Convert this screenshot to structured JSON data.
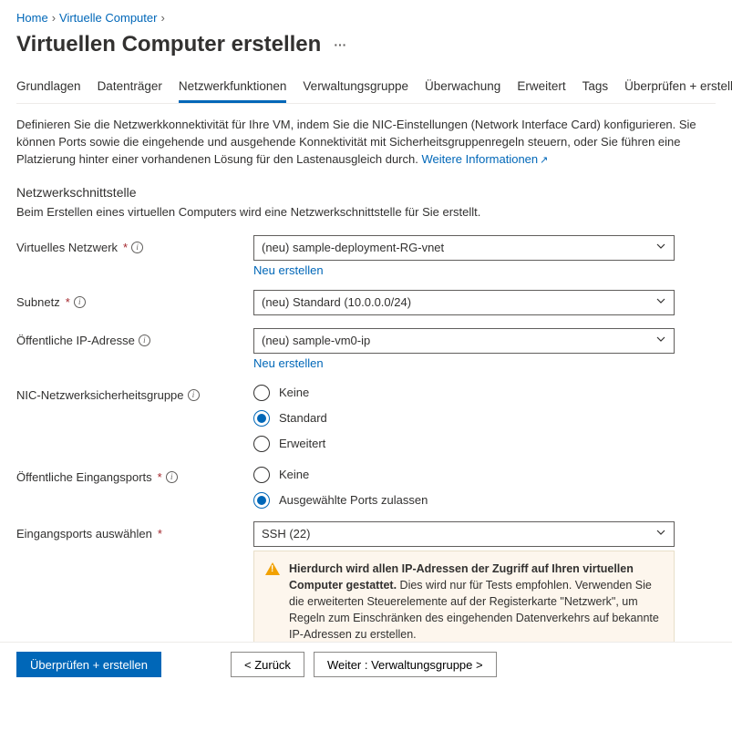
{
  "breadcrumb": {
    "home": "Home",
    "vms": "Virtuelle Computer"
  },
  "title": "Virtuellen Computer erstellen",
  "tabs": {
    "basics": "Grundlagen",
    "disks": "Datenträger",
    "networking": "Netzwerkfunktionen",
    "management": "Verwaltungsgruppe",
    "monitoring": "Überwachung",
    "advanced": "Erweitert",
    "tags": "Tags",
    "review": "Überprüfen + erstellen"
  },
  "intro": {
    "text": "Definieren Sie die Netzwerkkonnektivität für Ihre VM, indem Sie die NIC-Einstellungen (Network Interface Card) konfigurieren. Sie können Ports sowie die eingehende und ausgehende Konnektivität mit Sicherheitsgruppenregeln steuern, oder Sie führen eine Platzierung hinter einer vorhandenen Lösung für den Lastenausgleich durch.",
    "learnMore": "Weitere Informationen"
  },
  "section": {
    "title": "Netzwerkschnittstelle",
    "desc": "Beim Erstellen eines virtuellen Computers wird eine Netzwerkschnittstelle für Sie erstellt."
  },
  "fields": {
    "vnet": {
      "label": "Virtuelles Netzwerk",
      "value": "(neu) sample-deployment-RG-vnet",
      "createNew": "Neu erstellen"
    },
    "subnet": {
      "label": "Subnetz",
      "value": "(neu) Standard (10.0.0.0/24)"
    },
    "publicIp": {
      "label": "Öffentliche IP-Adresse",
      "value": "(neu) sample-vm0-ip",
      "createNew": "Neu erstellen"
    },
    "nsg": {
      "label": "NIC-Netzwerksicherheitsgruppe",
      "options": {
        "none": "Keine",
        "basic": "Standard",
        "advanced": "Erweitert"
      }
    },
    "inboundPorts": {
      "label": "Öffentliche Eingangsports",
      "options": {
        "none": "Keine",
        "allow": "Ausgewählte Ports zulassen"
      }
    },
    "selectPorts": {
      "label": "Eingangsports auswählen",
      "value": "SSH (22)"
    }
  },
  "warning": {
    "bold": "Hierdurch wird allen IP-Adressen der Zugriff auf Ihren virtuellen Computer gestattet.",
    "rest": " Dies wird nur für Tests empfohlen. Verwenden Sie die erweiterten Steuerelemente auf der Registerkarte \"Netzwerk\", um Regeln zum Einschränken des eingehenden Datenverkehrs auf bekannte IP-Adressen zu erstellen."
  },
  "footer": {
    "review": "Überprüfen + erstellen",
    "back": "< Zurück",
    "next": "Weiter : Verwaltungsgruppe >"
  }
}
